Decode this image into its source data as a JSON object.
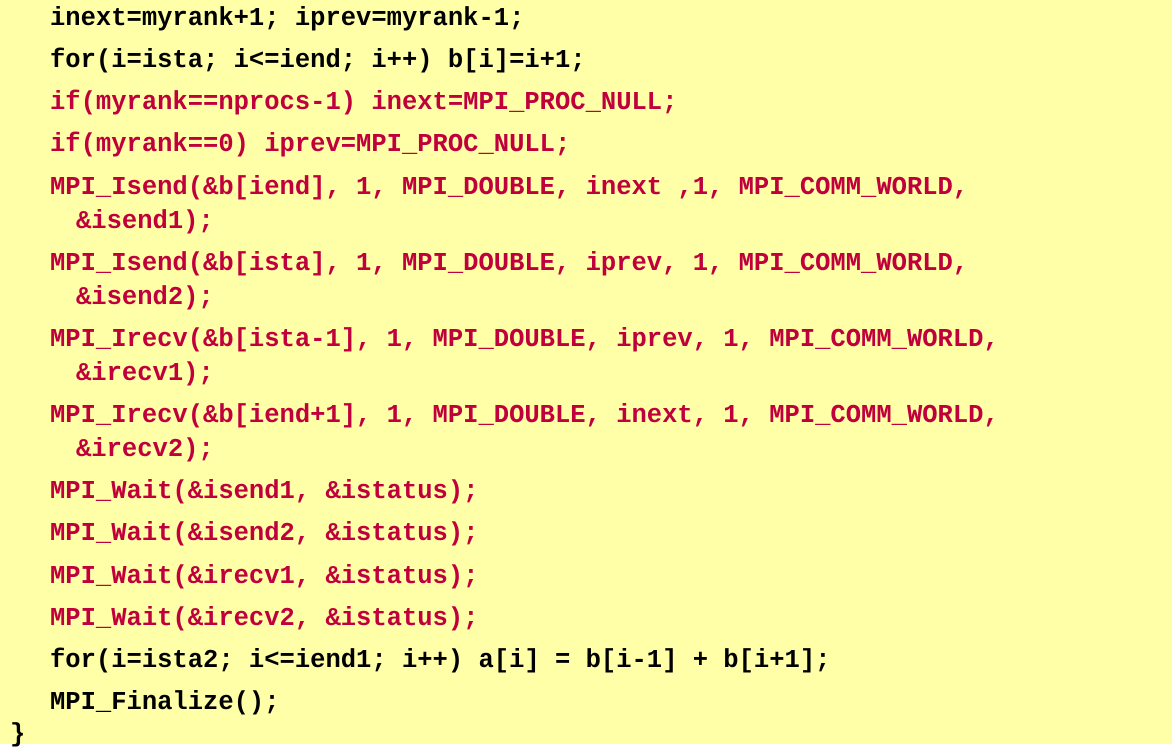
{
  "colors": {
    "background": "#ffffa8",
    "default_text": "#000000",
    "highlight_text": "#c0003c"
  },
  "code_lines": [
    "inext=myrank+1; iprev=myrank-1;",
    "for(i=ista; i<=iend; i++) b[i]=i+1;",
    "if(myrank==nprocs-1) inext=MPI_PROC_NULL;",
    "if(myrank==0) iprev=MPI_PROC_NULL;",
    "MPI_Isend(&b[iend], 1, MPI_DOUBLE, inext ,1, MPI_COMM_WORLD,",
    "&isend1);",
    "MPI_Isend(&b[ista], 1, MPI_DOUBLE, iprev, 1, MPI_COMM_WORLD,",
    "&isend2);",
    "MPI_Irecv(&b[ista-1], 1, MPI_DOUBLE, iprev, 1, MPI_COMM_WORLD,",
    "&irecv1);",
    "MPI_Irecv(&b[iend+1], 1, MPI_DOUBLE, inext, 1, MPI_COMM_WORLD,",
    "&irecv2);",
    "MPI_Wait(&isend1, &istatus);",
    "MPI_Wait(&isend2, &istatus);",
    "MPI_Wait(&irecv1, &istatus);",
    "MPI_Wait(&irecv2, &istatus);",
    "for(i=ista2; i<=iend1; i++) a[i] = b[i-1] + b[i+1];",
    "MPI_Finalize();",
    "}"
  ]
}
